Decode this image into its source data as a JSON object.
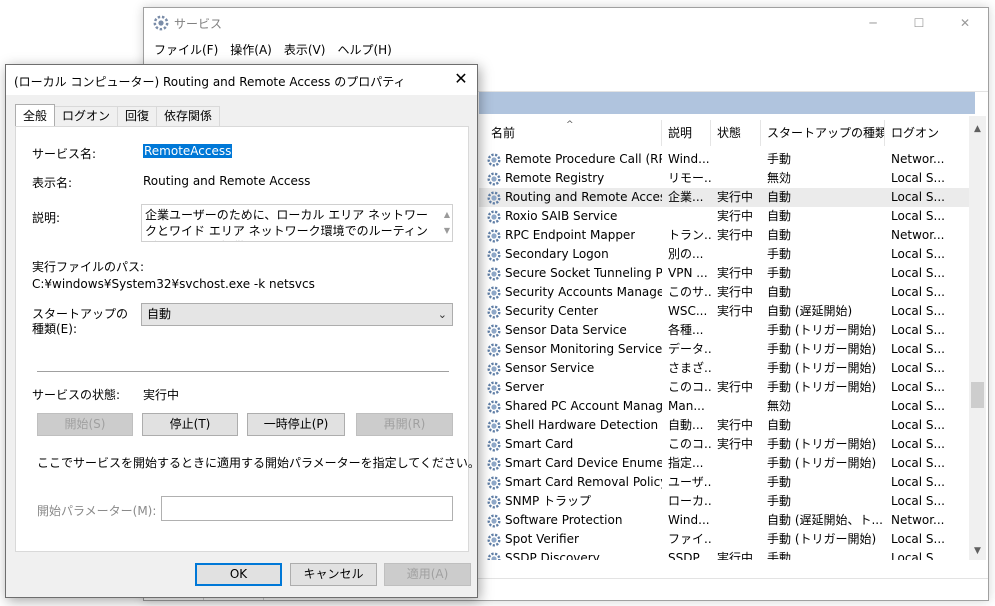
{
  "services_window": {
    "title": "サービス",
    "controls": {
      "minimize": "─",
      "maximize": "☐",
      "close": "✕"
    },
    "menu": [
      "ファイル(F)",
      "操作(A)",
      "表示(V)",
      "ヘルプ(H)"
    ],
    "columns": {
      "name": "名前",
      "description": "説明",
      "status": "状態",
      "startup_type": "スタートアップの種類",
      "logon": "ログオン"
    },
    "sort_indicator": "^",
    "rows": [
      {
        "name": "Remote Procedure Call (RPC...",
        "desc": "Wind...",
        "status": "",
        "startup": "手動",
        "logon": "Networ..."
      },
      {
        "name": "Remote Registry",
        "desc": "リモー...",
        "status": "",
        "startup": "無効",
        "logon": "Local S..."
      },
      {
        "name": "Routing and Remote Access",
        "desc": "企業...",
        "status": "実行中",
        "startup": "自動",
        "logon": "Local S..."
      },
      {
        "name": "Roxio SAIB Service",
        "desc": "",
        "status": "実行中",
        "startup": "自動",
        "logon": "Local S..."
      },
      {
        "name": "RPC Endpoint Mapper",
        "desc": "トラン...",
        "status": "実行中",
        "startup": "自動",
        "logon": "Networ..."
      },
      {
        "name": "Secondary Logon",
        "desc": "別の...",
        "status": "",
        "startup": "手動",
        "logon": "Local S..."
      },
      {
        "name": "Secure Socket Tunneling Pr...",
        "desc": "VPN ...",
        "status": "実行中",
        "startup": "手動",
        "logon": "Local S..."
      },
      {
        "name": "Security Accounts Manager",
        "desc": "このサ...",
        "status": "実行中",
        "startup": "自動",
        "logon": "Local S..."
      },
      {
        "name": "Security Center",
        "desc": "WSC...",
        "status": "実行中",
        "startup": "自動 (遅延開始)",
        "logon": "Local S..."
      },
      {
        "name": "Sensor Data Service",
        "desc": "各種...",
        "status": "",
        "startup": "手動 (トリガー開始)",
        "logon": "Local S..."
      },
      {
        "name": "Sensor Monitoring Service",
        "desc": "データ...",
        "status": "",
        "startup": "手動 (トリガー開始)",
        "logon": "Local S..."
      },
      {
        "name": "Sensor Service",
        "desc": "さまざ...",
        "status": "",
        "startup": "手動 (トリガー開始)",
        "logon": "Local S..."
      },
      {
        "name": "Server",
        "desc": "このコ...",
        "status": "実行中",
        "startup": "手動 (トリガー開始)",
        "logon": "Local S..."
      },
      {
        "name": "Shared PC Account Manager",
        "desc": "Man...",
        "status": "",
        "startup": "無効",
        "logon": "Local S..."
      },
      {
        "name": "Shell Hardware Detection",
        "desc": "自動...",
        "status": "実行中",
        "startup": "自動",
        "logon": "Local S..."
      },
      {
        "name": "Smart Card",
        "desc": "このコ...",
        "status": "実行中",
        "startup": "手動 (トリガー開始)",
        "logon": "Local S..."
      },
      {
        "name": "Smart Card Device Enumera...",
        "desc": "指定...",
        "status": "",
        "startup": "手動 (トリガー開始)",
        "logon": "Local S..."
      },
      {
        "name": "Smart Card Removal Policy",
        "desc": "ユーザ...",
        "status": "",
        "startup": "手動",
        "logon": "Local S..."
      },
      {
        "name": "SNMP トラップ",
        "desc": "ローカ...",
        "status": "",
        "startup": "手動",
        "logon": "Local S..."
      },
      {
        "name": "Software Protection",
        "desc": "Wind...",
        "status": "",
        "startup": "自動 (遅延開始、ト...",
        "logon": "Networ..."
      },
      {
        "name": "Spot Verifier",
        "desc": "ファイ...",
        "status": "",
        "startup": "手動 (トリガー開始)",
        "logon": "Local S..."
      },
      {
        "name": "SSDP Discovery",
        "desc": "SSDP...",
        "status": "実行中",
        "startup": "手動",
        "logon": "Local S..."
      }
    ],
    "selected_row_index": 2,
    "scrollbar": {
      "up": "▲",
      "down": "▼"
    }
  },
  "dialog": {
    "title": "(ローカル コンピューター) Routing and Remote Access のプロパティ",
    "close_glyph": "✕",
    "tabs": [
      "全般",
      "ログオン",
      "回復",
      "依存関係"
    ],
    "service_name_label": "サービス名:",
    "service_name_value": "RemoteAccess",
    "display_name_label": "表示名:",
    "display_name_value": "Routing and Remote Access",
    "description_label": "説明:",
    "description_value": "企業ユーザーのために、ローカル エリア ネットワークとワイド エリア ネットワーク環境でのルーティング サービスを提供します。",
    "desc_scroll_up": "▲",
    "desc_scroll_down": "▼",
    "exe_path_label": "実行ファイルのパス:",
    "exe_path_value": "C:¥windows¥System32¥svchost.exe -k netsvcs",
    "startup_type_label_line1": "スタートアップの",
    "startup_type_label_line2": "種類(E):",
    "startup_type_value": "自動",
    "select_arrow": "⌄",
    "service_status_label": "サービスの状態:",
    "service_status_value": "実行中",
    "buttons": {
      "start": "開始(S)",
      "stop": "停止(T)",
      "pause": "一時停止(P)",
      "resume": "再開(R)"
    },
    "hint_text": "ここでサービスを開始するときに適用する開始パラメーターを指定してください。",
    "start_params_label": "開始パラメーター(M):",
    "start_params_value": "",
    "ok": "OK",
    "cancel": "キャンセル",
    "apply": "適用(A)"
  }
}
